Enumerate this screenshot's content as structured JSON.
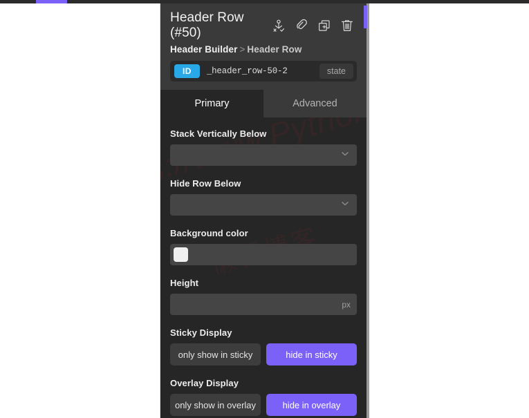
{
  "window": {
    "accent_purple": "#7b61f8",
    "panel_bg": "#262626",
    "header_bg": "#3a3a3a"
  },
  "watermark": {
    "line1": "https://www.Pythonthree.com",
    "line2": "懒得博客"
  },
  "panel": {
    "title": "Header Row (#50)",
    "icons": [
      {
        "name": "select-parent-icon",
        "label": "select parent"
      },
      {
        "name": "link-icon",
        "label": "link"
      },
      {
        "name": "duplicate-icon",
        "label": "duplicate"
      },
      {
        "name": "trash-icon",
        "label": "delete"
      }
    ],
    "breadcrumb": {
      "root": "Header Builder",
      "separator": ">",
      "leaf": "Header Row"
    },
    "id_bar": {
      "badge": "ID",
      "value": "_header_row-50-2",
      "state_label": "state"
    },
    "tabs": [
      {
        "label": "Primary",
        "active": true
      },
      {
        "label": "Advanced",
        "active": false
      }
    ],
    "fields": {
      "stack_vertically_below": {
        "label": "Stack Vertically Below",
        "value": "",
        "placeholder": ""
      },
      "hide_row_below": {
        "label": "Hide Row Below",
        "value": "",
        "placeholder": ""
      },
      "background_color": {
        "label": "Background color",
        "swatch_color": "#f0f0f0"
      },
      "height": {
        "label": "Height",
        "value": "",
        "unit": "px"
      },
      "sticky_display": {
        "label": "Sticky Display",
        "option_off": "only show in sticky",
        "option_on": "hide in sticky",
        "selected": "hide in sticky"
      },
      "overlay_display": {
        "label": "Overlay Display",
        "option_off": "only show in overlay",
        "option_on": "hide in overlay",
        "selected": "hide in overlay"
      }
    }
  }
}
